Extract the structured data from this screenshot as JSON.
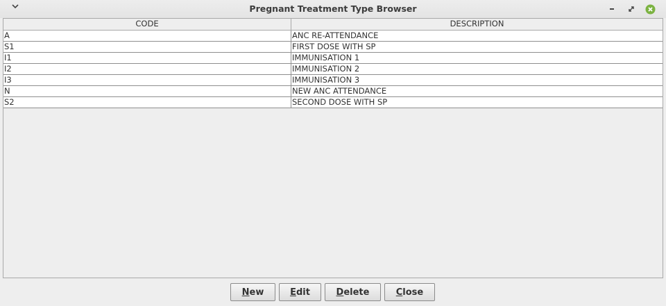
{
  "window": {
    "title": "Pregnant Treatment Type Browser",
    "menu_icon": "chevron-down-icon",
    "controls": [
      "minimize-icon",
      "maximize-icon",
      "close-icon"
    ],
    "close_color": "#7cb342"
  },
  "table": {
    "columns": [
      "CODE",
      "DESCRIPTION"
    ],
    "rows": [
      {
        "code": "A",
        "description": "ANC RE-ATTENDANCE"
      },
      {
        "code": "S1",
        "description": "FIRST DOSE WITH SP"
      },
      {
        "code": "I1",
        "description": "IMMUNISATION 1"
      },
      {
        "code": "I2",
        "description": "IMMUNISATION 2"
      },
      {
        "code": "I3",
        "description": "IMMUNISATION 3"
      },
      {
        "code": "N",
        "description": "NEW ANC ATTENDANCE"
      },
      {
        "code": "S2",
        "description": "SECOND DOSE WITH SP"
      }
    ]
  },
  "buttons": {
    "new": {
      "mnemonic": "N",
      "rest": "ew"
    },
    "edit": {
      "mnemonic": "E",
      "rest": "dit"
    },
    "delete": {
      "mnemonic": "D",
      "rest": "elete"
    },
    "close": {
      "mnemonic": "C",
      "rest": "lose"
    }
  }
}
